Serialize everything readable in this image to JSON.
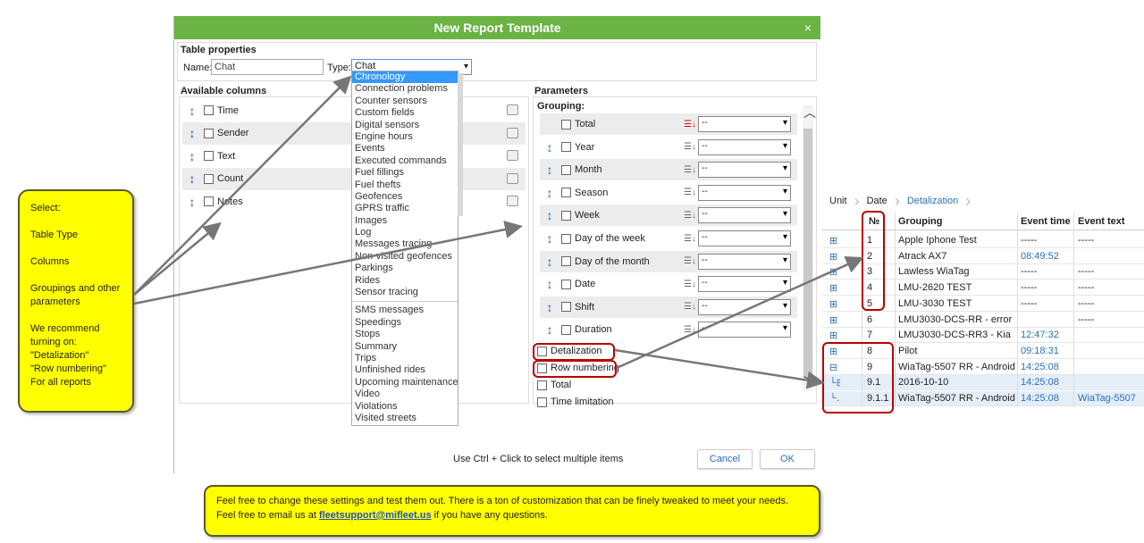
{
  "callout_left": {
    "line1": "Select:",
    "line2": "Table Type",
    "line3": "Columns",
    "line4": "Groupings and other parameters",
    "line5": "We recommend turning on:",
    "line6": "\"Detalization\"",
    "line7": "\"Row numbering\"",
    "line8": "For all reports"
  },
  "callout_bottom": {
    "text_before": "Feel free to change these settings and test them out. There is a ton of customization that can be finely tweaked to meet your needs. Feel free to email us at ",
    "email": "fleetsupport@mifleet.us",
    "text_after": " if you have any questions."
  },
  "dialog": {
    "title": "New Report Template",
    "close": "×",
    "table_properties": "Table properties",
    "name_label": "Name:",
    "name_value": "Chat",
    "type_label": "Type:",
    "type_value": "Chat",
    "available_columns": "Available columns",
    "parameters": "Parameters",
    "grouping": "Grouping:",
    "footer_hint": "Use Ctrl + Click to select multiple items",
    "cancel": "Cancel",
    "ok": "OK"
  },
  "columns": [
    "Time",
    "Sender",
    "Text",
    "Count",
    "Notes"
  ],
  "groupings": [
    {
      "label": "Total",
      "value": "--",
      "sort_active": true
    },
    {
      "label": "Year",
      "value": "--"
    },
    {
      "label": "Month",
      "value": "--"
    },
    {
      "label": "Season",
      "value": "--"
    },
    {
      "label": "Week",
      "value": "--"
    },
    {
      "label": "Day of the week",
      "value": "--"
    },
    {
      "label": "Day of the month",
      "value": "--"
    },
    {
      "label": "Date",
      "value": "--"
    },
    {
      "label": "Shift",
      "value": "--"
    },
    {
      "label": "Duration",
      "value": "--"
    }
  ],
  "checks": {
    "detalization": "Detalization",
    "row_numbering": "Row numbering",
    "total": "Total",
    "time_limitation": "Time limitation"
  },
  "type_options_top": [
    "Chronology",
    "Connection problems",
    "Counter sensors",
    "Custom fields",
    "Digital sensors",
    "Engine hours",
    "Events",
    "Executed commands",
    "Fuel fillings",
    "Fuel thefts",
    "Geofences",
    "GPRS traffic",
    "Images",
    "Log",
    "Messages tracing",
    "Non-visited geofences",
    "Parkings",
    "Rides",
    "Sensor tracing"
  ],
  "type_options_bottom": [
    "SMS messages",
    "Speedings",
    "Stops",
    "Summary",
    "Trips",
    "Unfinished rides",
    "Upcoming maintenance",
    "Video",
    "Violations",
    "Visited streets"
  ],
  "report": {
    "crumbs": [
      "Unit",
      "Date",
      "Detalization"
    ],
    "headers": {
      "no": "№",
      "grouping": "Grouping",
      "event_time": "Event time",
      "event_text": "Event text"
    },
    "rows": [
      {
        "exp": "⊞",
        "no": "1",
        "grouping": "Apple Iphone Test",
        "time": "-----",
        "text": "-----"
      },
      {
        "exp": "⊞",
        "no": "2",
        "grouping": "Atrack AX7",
        "time": "08:49:52",
        "text": ""
      },
      {
        "exp": "⊞",
        "no": "3",
        "grouping": "Lawless WiaTag",
        "time": "-----",
        "text": "-----"
      },
      {
        "exp": "⊞",
        "no": "4",
        "grouping": "LMU-2620 TEST",
        "time": "-----",
        "text": "-----"
      },
      {
        "exp": "⊞",
        "no": "5",
        "grouping": "LMU-3030 TEST",
        "time": "-----",
        "text": "-----"
      },
      {
        "exp": "⊞",
        "no": "6",
        "grouping": "LMU3030-DCS-RR - error",
        "time": "",
        "text": "-----"
      },
      {
        "exp": "⊞",
        "no": "7",
        "grouping": "LMU3030-DCS-RR3 - Kia",
        "time": "12:47:32",
        "text": ""
      },
      {
        "exp": "⊞",
        "no": "8",
        "grouping": "Pilot",
        "time": "09:18:31",
        "text": ""
      },
      {
        "exp": "⊟",
        "no": "9",
        "grouping": "WiaTag-5507 RR - Android",
        "time": "14:25:08",
        "text": ""
      },
      {
        "exp": "└⊟",
        "no": "9.1",
        "grouping": "2016-10-10",
        "time": "14:25:08",
        "text": ""
      },
      {
        "exp": "└....",
        "no": "9.1.1",
        "grouping": "WiaTag-5507 RR - Android",
        "time": "14:25:08",
        "text": "WiaTag-5507"
      }
    ]
  }
}
